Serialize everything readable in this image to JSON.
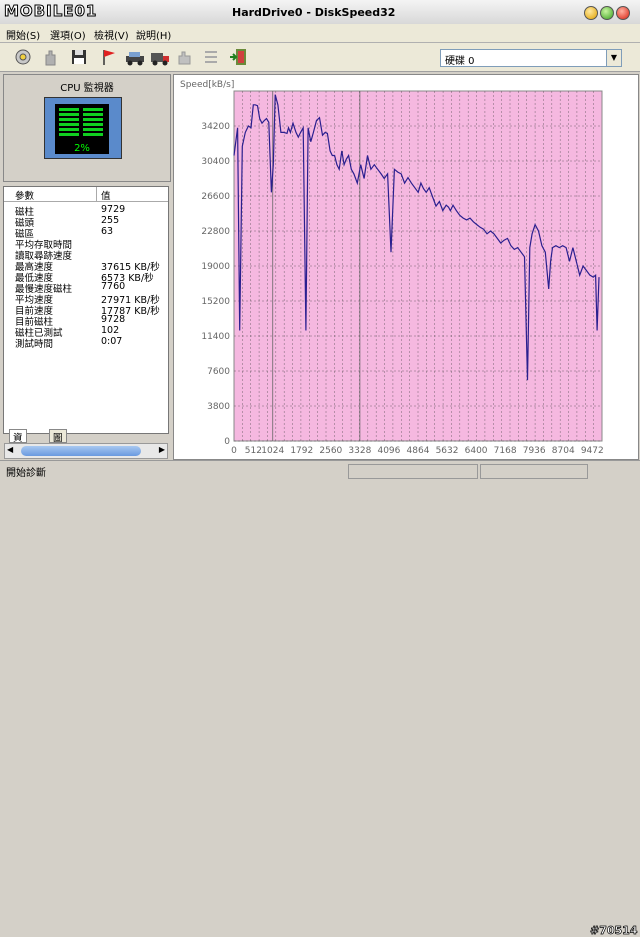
{
  "app": {
    "logo_text": "MOBILE01",
    "window_title": "HardDrive0 - DiskSpeed32"
  },
  "menu": [
    "開始(S)",
    "選項(O)",
    "檢視(V)",
    "說明(H)"
  ],
  "drive_select": {
    "value": "硬碟 0"
  },
  "cpu_monitor": {
    "title": "CPU 監視器",
    "percent": "2%"
  },
  "stats": {
    "header_param": "參數",
    "header_value": "值",
    "rows": [
      {
        "k": "磁柱",
        "v": "9729"
      },
      {
        "k": "磁頭",
        "v": "255"
      },
      {
        "k": "磁區",
        "v": "63"
      },
      {
        "k": "平均存取時間",
        "v": ""
      },
      {
        "k": "讀取尋跡速度",
        "v": ""
      },
      {
        "k": "最高速度",
        "v": "37615 KB/秒"
      },
      {
        "k": "最低速度",
        "v": "6573 KB/秒"
      },
      {
        "k": "最慢速度磁柱",
        "v": "7760"
      },
      {
        "k": "平均速度",
        "v": "27971 KB/秒"
      },
      {
        "k": "目前速度",
        "v": "17787 KB/秒"
      },
      {
        "k": "目前磁柱",
        "v": "9728"
      },
      {
        "k": "磁柱已測試",
        "v": "102"
      },
      {
        "k": "測試時間",
        "v": "0:07"
      }
    ]
  },
  "tabs": [
    "資訊",
    "圖例"
  ],
  "status": {
    "text": "開始診斷",
    "watermark": "#70514"
  },
  "chart_data": {
    "type": "line",
    "ylabel": "Speed[kB/s]",
    "ylim": [
      0,
      38000
    ],
    "xlim": [
      0,
      9729
    ],
    "xticks": [
      0,
      512,
      1024,
      1792,
      2560,
      3328,
      4096,
      4864,
      5632,
      6400,
      7168,
      7936,
      8704,
      9472
    ],
    "yticks": [
      0,
      3800,
      7600,
      11400,
      15200,
      19000,
      22800,
      26600,
      30400,
      34200
    ],
    "colors": {
      "background": "#f5b8e0",
      "line": "#2a1f8f",
      "grid": "#404040"
    },
    "x": [
      0,
      96,
      150,
      220,
      300,
      380,
      450,
      510,
      560,
      620,
      680,
      740,
      800,
      860,
      920,
      990,
      1040,
      1090,
      1160,
      1240,
      1320,
      1400,
      1440,
      1490,
      1560,
      1640,
      1700,
      1760,
      1830,
      1900,
      1960,
      2030,
      2100,
      2180,
      2260,
      2340,
      2410,
      2470,
      2540,
      2600,
      2660,
      2720,
      2780,
      2850,
      2910,
      2970,
      3030,
      3100,
      3170,
      3260,
      3350,
      3440,
      3530,
      3620,
      3710,
      3800,
      3890,
      3970,
      4060,
      4150,
      4240,
      4330,
      4420,
      4510,
      4600,
      4690,
      4780,
      4870,
      4940,
      5010,
      5080,
      5160,
      5250,
      5340,
      5430,
      5520,
      5610,
      5670,
      5720,
      5790,
      5880,
      5970,
      6060,
      6150,
      6240,
      6330,
      6420,
      6510,
      6600,
      6690,
      6780,
      6870,
      6960,
      7050,
      7140,
      7230,
      7320,
      7410,
      7500,
      7590,
      7680,
      7760,
      7820,
      7880,
      7960,
      8050,
      8140,
      8230,
      8320,
      8370,
      8420,
      8510,
      8600,
      8690,
      8780,
      8870,
      8960,
      9050,
      9140,
      9230,
      9320,
      9410,
      9500,
      9560,
      9600,
      9650,
      9690,
      9729
    ],
    "values": [
      31000,
      34000,
      12000,
      32000,
      33500,
      34200,
      34000,
      36500,
      36500,
      36400,
      35000,
      34500,
      34800,
      35000,
      34600,
      27000,
      30000,
      37600,
      36500,
      33500,
      33500,
      33400,
      34000,
      33500,
      34500,
      33500,
      33000,
      33500,
      34000,
      12000,
      34000,
      32500,
      33500,
      34800,
      35100,
      33200,
      33500,
      33400,
      31500,
      31000,
      31000,
      30000,
      29500,
      31500,
      30000,
      30600,
      31000,
      29500,
      29000,
      28000,
      30000,
      28500,
      31000,
      29500,
      30000,
      29500,
      29000,
      28500,
      29000,
      20500,
      29500,
      29200,
      29000,
      28000,
      28600,
      28000,
      27500,
      27000,
      28000,
      27400,
      27000,
      27500,
      26500,
      25500,
      26000,
      25000,
      25600,
      25400,
      25000,
      25600,
      25000,
      24500,
      24200,
      24000,
      24200,
      23800,
      23500,
      23200,
      23000,
      22500,
      22800,
      22500,
      22000,
      21500,
      21800,
      22000,
      21200,
      20800,
      21000,
      20500,
      20000,
      6600,
      21000,
      22500,
      23500,
      22800,
      21200,
      20500,
      16500,
      19500,
      21000,
      21200,
      21000,
      21200,
      21000,
      19500,
      21000,
      19500,
      18000,
      19000,
      18500,
      18000,
      17800,
      18000,
      12000,
      17800
    ]
  }
}
